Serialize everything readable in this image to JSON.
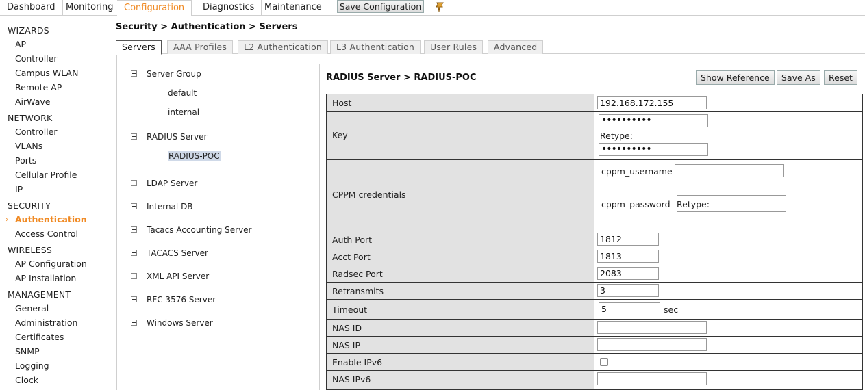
{
  "topnav": {
    "tabs": [
      "Dashboard",
      "Monitoring",
      "Configuration",
      "Diagnostics",
      "Maintenance"
    ],
    "active": "Configuration",
    "save_label": "Save Configuration",
    "pin_icon": "pin-icon"
  },
  "sidebar": {
    "wizards": {
      "heading": "WIZARDS",
      "items": [
        "AP",
        "Controller",
        "Campus WLAN",
        "Remote AP",
        "AirWave"
      ]
    },
    "network": {
      "heading": "NETWORK",
      "items": [
        "Controller",
        "VLANs",
        "Ports",
        "Cellular Profile",
        "IP"
      ]
    },
    "security": {
      "heading": "SECURITY",
      "items": [
        "Authentication",
        "Access Control"
      ],
      "active": "Authentication"
    },
    "wireless": {
      "heading": "WIRELESS",
      "items": [
        "AP Configuration",
        "AP Installation"
      ]
    },
    "management": {
      "heading": "MANAGEMENT",
      "items": [
        "General",
        "Administration",
        "Certificates",
        "SNMP",
        "Logging",
        "Clock"
      ]
    }
  },
  "main": {
    "breadcrumb": "Security > Authentication > Servers",
    "subtabs": [
      "Servers",
      "AAA Profiles",
      "L2 Authentication",
      "L3 Authentication",
      "User Rules",
      "Advanced"
    ],
    "active_subtab": "Servers"
  },
  "tree": {
    "server_group": {
      "label": "Server Group",
      "children": [
        "default",
        "internal"
      ]
    },
    "radius_server": {
      "label": "RADIUS Server",
      "children": [
        "RADIUS-POC"
      ]
    },
    "ldap_server": "LDAP Server",
    "internal_db": "Internal DB",
    "tacacs_accounting": "Tacacs Accounting Server",
    "tacacs_server": "TACACS Server",
    "xml_api": "XML API Server",
    "rfc3576": "RFC 3576 Server",
    "windows_server": "Windows Server"
  },
  "panel": {
    "title": "RADIUS Server > RADIUS-POC",
    "buttons": {
      "show_reference": "Show Reference",
      "save_as": "Save As",
      "reset": "Reset"
    },
    "fields": {
      "host": {
        "label": "Host",
        "value": "192.168.172.155"
      },
      "key": {
        "label": "Key",
        "value": "••••••••••",
        "retype_label": "Retype:",
        "retype_value": "••••••••••"
      },
      "cppm": {
        "label": "CPPM credentials",
        "username_label": "cppm_username",
        "password_label": "cppm_password",
        "retype_label": "Retype:",
        "username_value": "",
        "password_value": "",
        "retype_value": ""
      },
      "auth_port": {
        "label": "Auth Port",
        "value": "1812"
      },
      "acct_port": {
        "label": "Acct Port",
        "value": "1813"
      },
      "radsec_port": {
        "label": "Radsec Port",
        "value": "2083"
      },
      "retransmits": {
        "label": "Retransmits",
        "value": "3"
      },
      "timeout": {
        "label": "Timeout",
        "value": "5",
        "unit": "sec"
      },
      "nas_id": {
        "label": "NAS ID",
        "value": ""
      },
      "nas_ip": {
        "label": "NAS IP",
        "value": ""
      },
      "enable_ipv6": {
        "label": "Enable IPv6",
        "checked": false
      },
      "nas_ipv6": {
        "label": "NAS IPv6",
        "value": ""
      }
    }
  }
}
